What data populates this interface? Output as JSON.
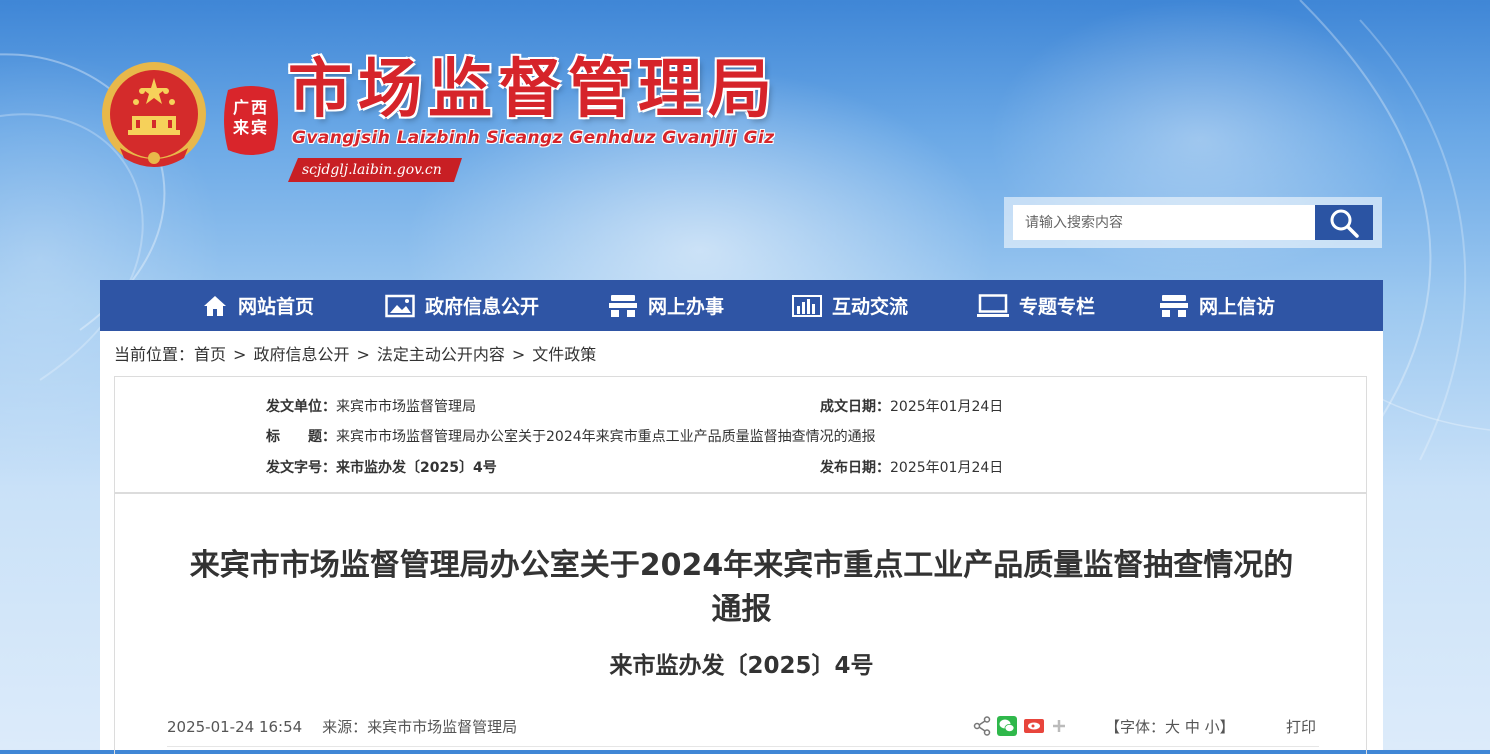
{
  "header": {
    "title": "市场监督管理局",
    "subtitle": "Gvangjsih Laizbinh Sicangz Genhduz Gvanjlij Giz",
    "domain": "scjdglj.laibin.gov.cn",
    "region_line1": "广西",
    "region_line2": "来宾",
    "emblem_icon": "national-emblem-icon"
  },
  "search": {
    "placeholder": "请输入搜索内容",
    "icon": "search-icon"
  },
  "nav": {
    "items": [
      {
        "label": "网站首页",
        "icon": "home-icon"
      },
      {
        "label": "政府信息公开",
        "icon": "image-icon"
      },
      {
        "label": "网上办事",
        "icon": "desk-icon"
      },
      {
        "label": "互动交流",
        "icon": "bar-chart-icon"
      },
      {
        "label": "专题专栏",
        "icon": "monitor-icon"
      },
      {
        "label": "网上信访",
        "icon": "desk-icon"
      }
    ]
  },
  "breadcrumb": {
    "prefix": "当前位置：",
    "items": [
      "首页",
      "政府信息公开",
      "法定主动公开内容",
      "文件政策"
    ],
    "separator": ">"
  },
  "meta": {
    "issuer_label": "发文单位：",
    "issuer": "来宾市市场监督管理局",
    "date_label": "成文日期：",
    "date": "2025年01月24日",
    "title_label": "标　　题：",
    "title": "来宾市市场监督管理局办公室关于2024年来宾市重点工业产品质量监督抽查情况的通报",
    "docno_label": "发文字号：",
    "docno": "来市监办发〔2025〕4号",
    "publish_label": "发布日期：",
    "publish": "2025年01月24日"
  },
  "article": {
    "title_line1": "来宾市市场监督管理局办公室关于2024年来宾市重点工业产品质量监督抽查情况的",
    "title_line2": "通报",
    "doc_number": "来市监办发〔2025〕4号",
    "datetime": "2025-01-24 16:54",
    "source": "来源：来宾市市场监督管理局",
    "font_label": "【字体：",
    "font_large": "大",
    "font_medium": "中",
    "font_small": "小",
    "font_close": "】",
    "print": "打印"
  },
  "colors": {
    "nav_bg": "#2f55a5",
    "title_red": "#d6242a",
    "search_btn": "#2b54a3"
  }
}
